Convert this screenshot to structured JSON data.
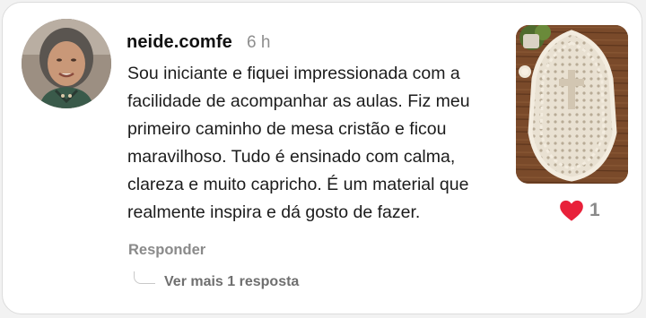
{
  "comment": {
    "username": "neide.comfe",
    "time": "6 h",
    "lines": [
      "Sou iniciante e fiquei impressionada com a",
      "facilidade de acompanhar as aulas. Fiz meu",
      "primeiro caminho de mesa cristão e ficou",
      "maravilhoso. Tudo é ensinado com calma,",
      "clareza e muito capricho. É um material que",
      "realmente inspira e dá gosto de fazer."
    ],
    "reply_label": "Responder",
    "more_replies_label": "Ver mais 1 resposta",
    "like_count": "1"
  },
  "icons": {
    "like": "heart-icon",
    "avatar": "profile-photo",
    "thumbnail": "crochet-table-runner-photo"
  },
  "colors": {
    "heart": "#e8213a",
    "muted_text": "#8a8a8a",
    "body_text": "#1c1c1c"
  }
}
